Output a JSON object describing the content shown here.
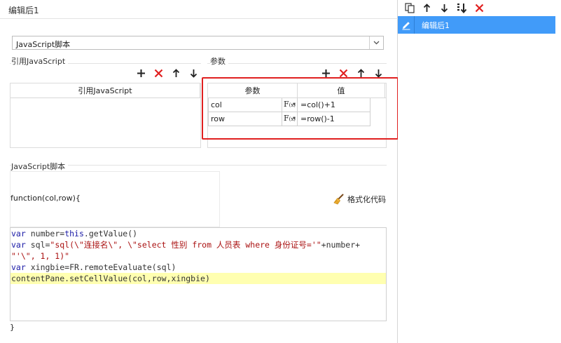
{
  "left_panel": {
    "title": "编辑后1",
    "script_type_select": {
      "value": "JavaScript脚本"
    },
    "ref_group": {
      "label": "引用JavaScript",
      "column_header": "引用JavaScript"
    },
    "params_group": {
      "label": "参数",
      "headers": {
        "name": "参数",
        "value": "值"
      },
      "rows": [
        {
          "name": "col",
          "fx": "F",
          "fx_sub": "(x)",
          "value": "=col()+1"
        },
        {
          "name": "row",
          "fx": "F",
          "fx_sub": "(x)",
          "value": "=row()-1"
        }
      ]
    },
    "script_group": {
      "label": "JavaScript脚本",
      "function_header": "function(col,row){",
      "format_button": "格式化代码",
      "closing_brace": "}"
    },
    "code_lines": [
      "var number=this.getValue()",
      "var sql=\"sql(\\\"连接名\\\", \\\"select 性别 from 人员表 where 身份证号='\"+number+",
      "\"'\\\", 1, 1)\"",
      "var xingbie=FR.remoteEvaluate(sql)",
      "contentPane.setCellValue(col,row,xingbie)"
    ]
  },
  "right_panel": {
    "items": [
      {
        "label": "编辑后1"
      }
    ]
  },
  "colors": {
    "accent": "#419bf9",
    "delete_red": "#e02020",
    "highlight_frame": "#e02020",
    "code_highlight": "#ffffb0"
  }
}
